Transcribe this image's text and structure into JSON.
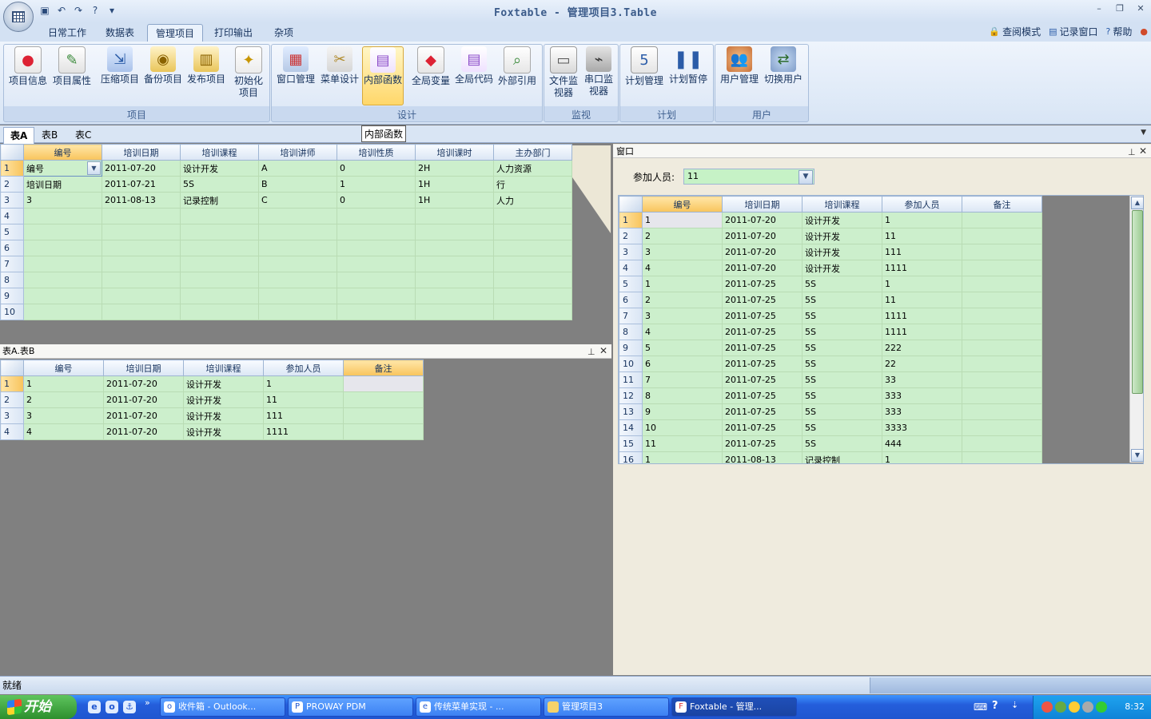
{
  "window": {
    "title": "Foxtable - 管理项目3.Table"
  },
  "ribbon": {
    "tabs": [
      "日常工作",
      "数据表",
      "管理项目",
      "打印输出",
      "杂项"
    ],
    "active_tab": "管理项目",
    "right_links": [
      "查阅模式",
      "记录窗口",
      "帮助"
    ],
    "groups": [
      {
        "label": "项目",
        "buttons": [
          "项目信息",
          "项目属性",
          "压缩项目",
          "备份项目",
          "发布项目",
          "初始化项目"
        ]
      },
      {
        "label": "设计",
        "buttons": [
          "窗口管理",
          "菜单设计",
          "内部函数",
          "全局变量",
          "全局代码",
          "外部引用"
        ]
      },
      {
        "label": "监视",
        "buttons": [
          "文件监视器",
          "串口监视器"
        ]
      },
      {
        "label": "计划",
        "buttons": [
          "计划管理",
          "计划暂停"
        ]
      },
      {
        "label": "用户",
        "buttons": [
          "用户管理",
          "切换用户"
        ]
      }
    ],
    "tooltip": "内部函数"
  },
  "doc_tabs": [
    "表A",
    "表B",
    "表C"
  ],
  "tableA": {
    "columns": [
      "编号",
      "培训日期",
      "培训课程",
      "培训讲师",
      "培训性质",
      "培训课时",
      "主办部门"
    ],
    "rows": [
      [
        "编号",
        "2011-07-20",
        "设计开发",
        "A",
        "0",
        "2H",
        "人力资源"
      ],
      [
        "培训日期",
        "2011-07-21",
        "5S",
        "B",
        "1",
        "1H",
        "行"
      ],
      [
        "3",
        "2011-08-13",
        "记录控制",
        "C",
        "0",
        "1H",
        "人力"
      ],
      [
        "",
        "",
        "",
        "",
        "",
        "",
        ""
      ],
      [
        "",
        "",
        "",
        "",
        "",
        "",
        ""
      ],
      [
        "",
        "",
        "",
        "",
        "",
        "",
        ""
      ],
      [
        "",
        "",
        "",
        "",
        "",
        "",
        ""
      ],
      [
        "",
        "",
        "",
        "",
        "",
        "",
        ""
      ],
      [
        "",
        "",
        "",
        "",
        "",
        "",
        ""
      ],
      [
        "",
        "",
        "",
        "",
        "",
        "",
        ""
      ]
    ]
  },
  "paneB": {
    "title": "表A.表B",
    "columns": [
      "编号",
      "培训日期",
      "培训课程",
      "参加人员",
      "备注"
    ],
    "rows": [
      [
        "1",
        "2011-07-20",
        "设计开发",
        "1",
        ""
      ],
      [
        "2",
        "2011-07-20",
        "设计开发",
        "11",
        ""
      ],
      [
        "3",
        "2011-07-20",
        "设计开发",
        "111",
        ""
      ],
      [
        "4",
        "2011-07-20",
        "设计开发",
        "1111",
        ""
      ]
    ]
  },
  "paneR": {
    "title": "窗口",
    "filter_label": "参加人员:",
    "filter_value": "11",
    "columns": [
      "编号",
      "培训日期",
      "培训课程",
      "参加人员",
      "备注"
    ],
    "rows": [
      [
        "1",
        "2011-07-20",
        "设计开发",
        "1",
        ""
      ],
      [
        "2",
        "2011-07-20",
        "设计开发",
        "11",
        ""
      ],
      [
        "3",
        "2011-07-20",
        "设计开发",
        "111",
        ""
      ],
      [
        "4",
        "2011-07-20",
        "设计开发",
        "1111",
        ""
      ],
      [
        "1",
        "2011-07-25",
        "5S",
        "1",
        ""
      ],
      [
        "2",
        "2011-07-25",
        "5S",
        "11",
        ""
      ],
      [
        "3",
        "2011-07-25",
        "5S",
        "1111",
        ""
      ],
      [
        "4",
        "2011-07-25",
        "5S",
        "1111",
        ""
      ],
      [
        "5",
        "2011-07-25",
        "5S",
        "222",
        ""
      ],
      [
        "6",
        "2011-07-25",
        "5S",
        "22",
        ""
      ],
      [
        "7",
        "2011-07-25",
        "5S",
        "33",
        ""
      ],
      [
        "8",
        "2011-07-25",
        "5S",
        "333",
        ""
      ],
      [
        "9",
        "2011-07-25",
        "5S",
        "333",
        ""
      ],
      [
        "10",
        "2011-07-25",
        "5S",
        "3333",
        ""
      ],
      [
        "11",
        "2011-07-25",
        "5S",
        "444",
        ""
      ],
      [
        "1",
        "2011-08-13",
        "记录控制",
        "1",
        ""
      ]
    ]
  },
  "status": {
    "text": "就绪"
  },
  "taskbar": {
    "start_label": "开始",
    "tasks": [
      "收件箱 - Outlook...",
      "PROWAY PDM",
      "传统菜单实现 - ...",
      "管理项目3",
      "Foxtable - 管理..."
    ],
    "active_task": "Foxtable - 管理...",
    "clock": "8:32"
  },
  "colors": {
    "grid_cell": "#ccefcc",
    "ribbon_bg": "#dfe9f7",
    "taskbar": "#245edb",
    "selected_header": "#f8c45c"
  }
}
